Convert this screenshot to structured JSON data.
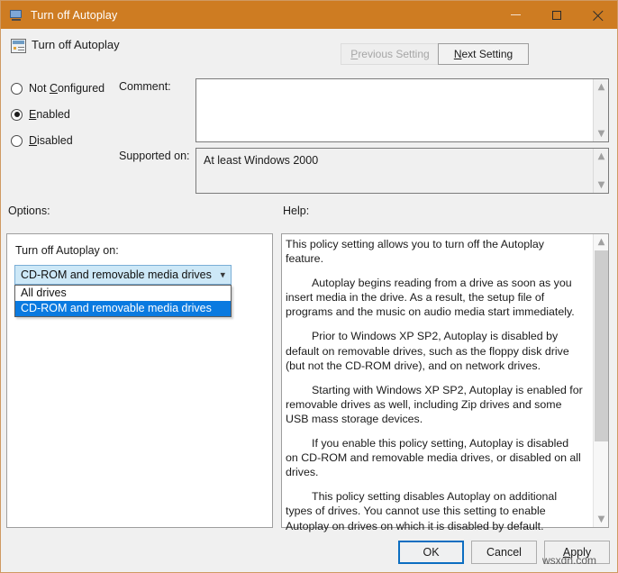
{
  "window": {
    "title": "Turn off Autoplay",
    "title_icon": "policy-monitor-icon",
    "minimize_label": "—",
    "maximize_label": "□",
    "close_label": "✕"
  },
  "header": {
    "policy_title": "Turn off Autoplay",
    "policy_icon": "group-policy-setting-icon",
    "previous_setting": "Previous Setting",
    "next_setting": "Next Setting",
    "previous_setting_enabled": false,
    "next_setting_enabled": true
  },
  "state": {
    "options": [
      {
        "label": "Not Configured",
        "selected": false
      },
      {
        "label": "Enabled",
        "selected": true
      },
      {
        "label": "Disabled",
        "selected": false
      }
    ]
  },
  "comment": {
    "label": "Comment:",
    "value": "",
    "scroll_up_icon": "chevron-up-icon",
    "scroll_down_icon": "chevron-down-icon"
  },
  "supported_on": {
    "label": "Supported on:",
    "value": "At least Windows 2000",
    "scroll_up_icon": "chevron-up-icon",
    "scroll_down_icon": "chevron-down-icon"
  },
  "sections": {
    "options_label": "Options:",
    "help_label": "Help:"
  },
  "options_panel": {
    "combo_label": "Turn off Autoplay on:",
    "combo_value": "CD-ROM and removable media drives",
    "combo_arrow_icon": "chevron-down-icon",
    "dropdown_open": true,
    "dropdown_items": [
      {
        "label": "All drives",
        "selected": false
      },
      {
        "label": "CD-ROM and removable media drives",
        "selected": true
      }
    ]
  },
  "help_panel": {
    "paragraphs": [
      {
        "text": "This policy setting allows you to turn off the Autoplay feature.",
        "indent": false
      },
      {
        "text": "Autoplay begins reading from a drive as soon as you insert media in the drive. As a result, the setup file of programs and the music on audio media start immediately.",
        "indent": true
      },
      {
        "text": "Prior to Windows XP SP2, Autoplay is disabled by default on removable drives, such as the floppy disk drive (but not the CD-ROM drive), and on network drives.",
        "indent": true
      },
      {
        "text": "Starting with Windows XP SP2, Autoplay is enabled for removable drives as well, including Zip drives and some USB mass storage devices.",
        "indent": true
      },
      {
        "text": "If you enable this policy setting, Autoplay is disabled on CD-ROM and removable media drives, or disabled on all drives.",
        "indent": true
      },
      {
        "text": "This policy setting disables Autoplay on additional types of drives. You cannot use this setting to enable Autoplay on drives on which it is disabled by default.",
        "indent": true
      }
    ],
    "scroll_up_icon": "chevron-up-icon",
    "scroll_down_icon": "chevron-down-icon"
  },
  "footer": {
    "ok": "OK",
    "cancel": "Cancel",
    "apply": "Apply",
    "default_button": "OK"
  },
  "watermark": "wsxdn.com",
  "colors": {
    "titlebar": "#ce7c22",
    "window_border": "#cf9a62",
    "dialog_background": "#f0f0f0",
    "selection_blue": "#0a7ae0",
    "combo_focus_fill": "#cde8f7",
    "default_button_outline": "#0c6ec1"
  }
}
